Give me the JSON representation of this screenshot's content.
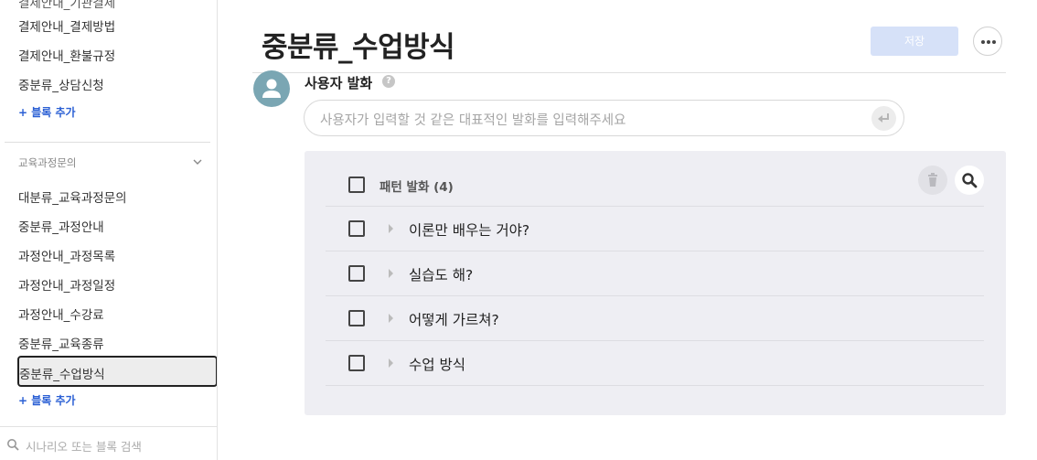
{
  "sidebar": {
    "cut_item": "결제안내_기관결제",
    "items_top": [
      "결제안내_결제방법",
      "결제안내_환불규정",
      "중분류_상담신청"
    ],
    "add_block_1": "+ 블록 추가",
    "group_label": "교육과정문의",
    "group_items": [
      "대분류_교육과정문의",
      "중분류_과정안내",
      "과정안내_과정목록",
      "과정안내_과정일정",
      "과정안내_수강료",
      "중분류_교육종류"
    ],
    "selected_item": "중분류_수업방식",
    "add_block_2": "+ 블록 추가",
    "search_placeholder": "시나리오 또는 블록 검색"
  },
  "main": {
    "title": "중분류_수업방식",
    "save_label": "저장",
    "user_utterance_label": "사용자 발화",
    "help_glyph": "?",
    "input_placeholder": "사용자가 입력할 것 같은 대표적인 발화를 입력해주세요",
    "pattern_header": "패턴 발화 (4)",
    "patterns": [
      "이론만 배우는 거야?",
      "실습도 해?",
      "어떻게 가르쳐?",
      "수업 방식"
    ]
  },
  "icons": {
    "more": "more-horizontal-icon",
    "trash": "trash-icon",
    "search": "search-icon",
    "enter": "enter-icon",
    "avatar": "user-avatar-icon",
    "chevron": "chevron-down-icon"
  },
  "colors": {
    "accent": "#2a5fd4",
    "save_disabled": "#d6e1f8",
    "panel_bg": "#eeeef3",
    "avatar_bg": "#7aa6b3"
  }
}
